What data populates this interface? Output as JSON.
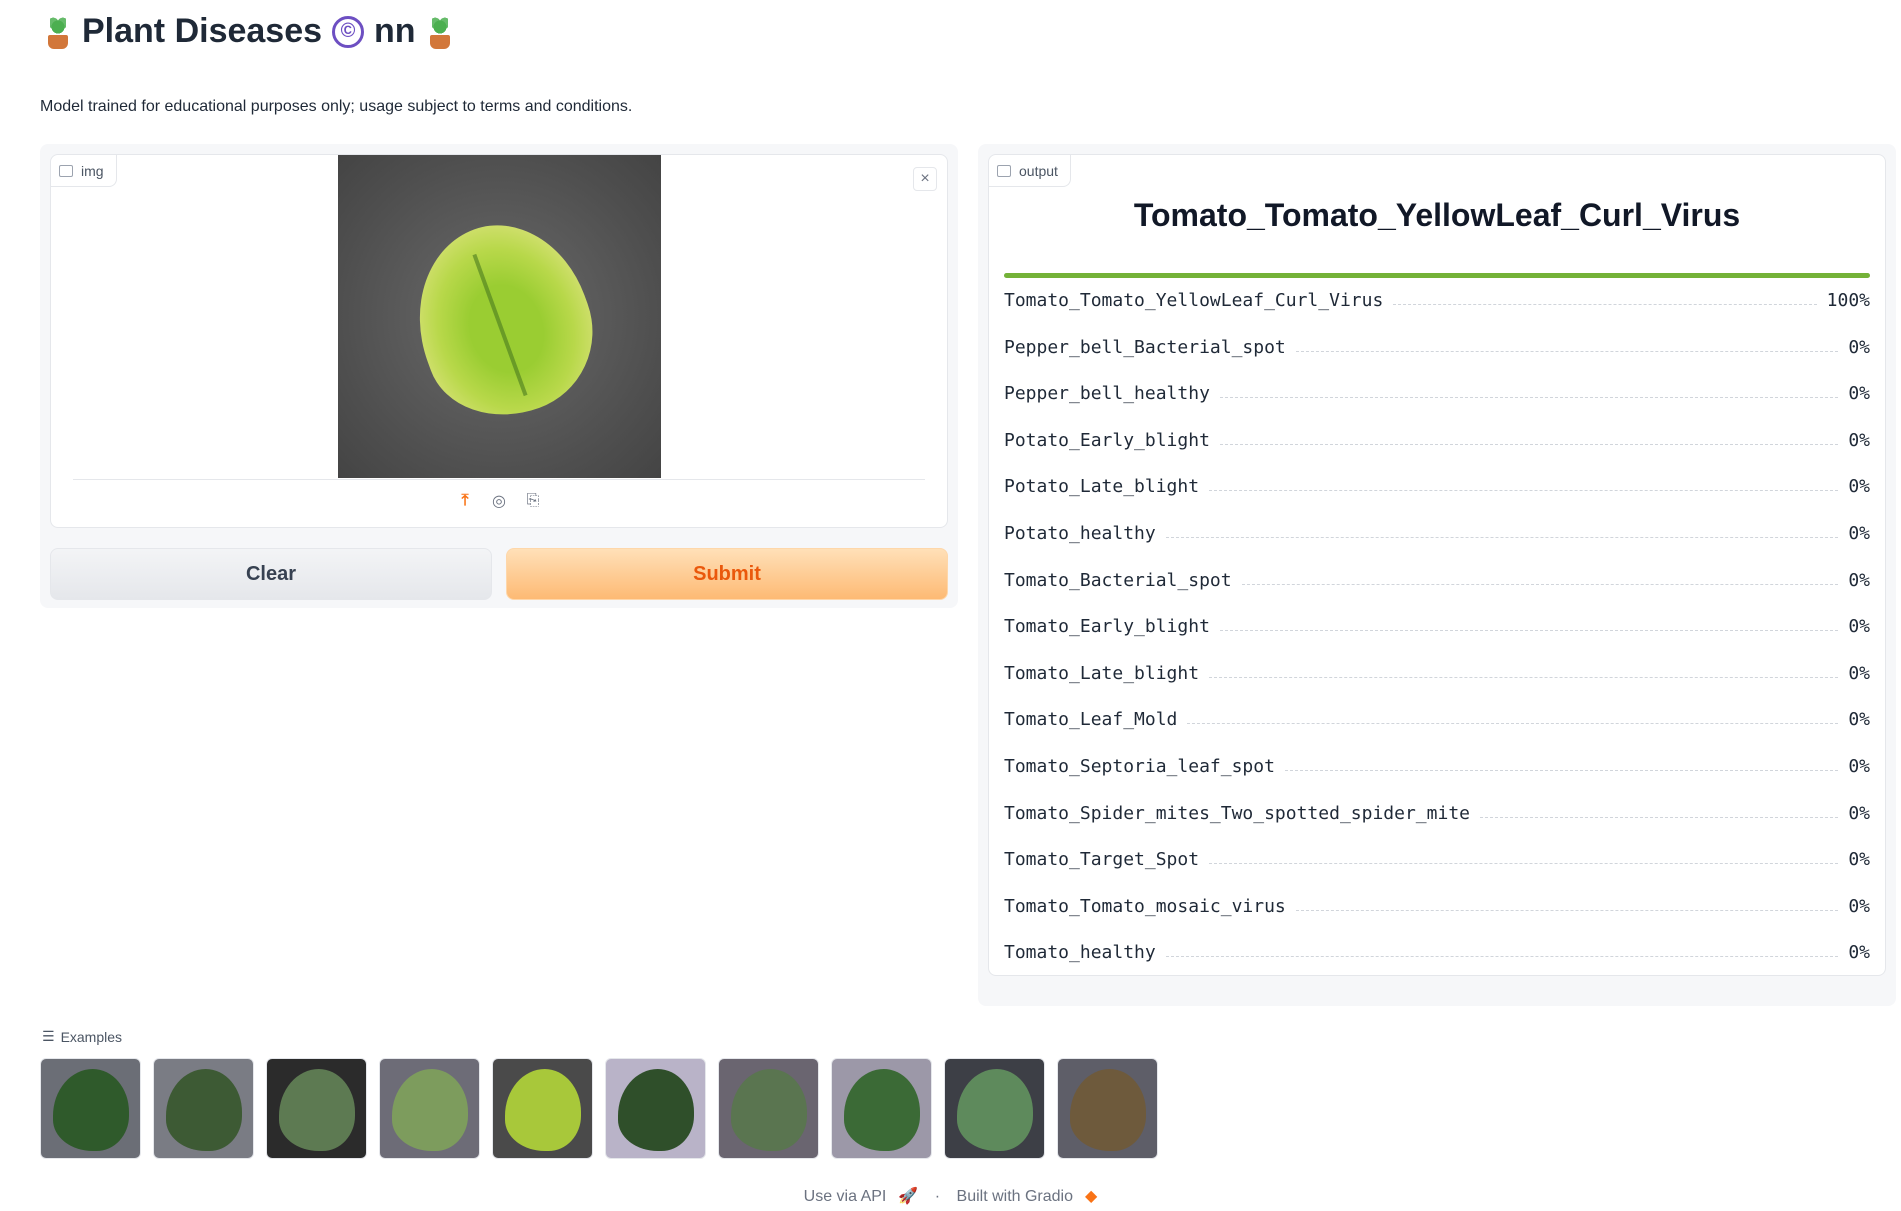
{
  "header": {
    "title": "Plant Diseases",
    "title_suffix": "nn",
    "copyright_glyph": "©",
    "description": "Model trained for educational purposes only; usage subject to terms and conditions."
  },
  "input": {
    "label": "img",
    "close_glyph": "×",
    "source_icons": [
      "upload-icon",
      "webcam-icon",
      "clipboard-icon"
    ]
  },
  "buttons": {
    "clear": "Clear",
    "submit": "Submit"
  },
  "output": {
    "label": "output",
    "top_class": "Tomato_Tomato_YellowLeaf_Curl_Virus",
    "top_confidence": 1.0,
    "confidences": [
      {
        "name": "Tomato_Tomato_YellowLeaf_Curl_Virus",
        "pct": "100%"
      },
      {
        "name": "Pepper_bell_Bacterial_spot",
        "pct": "0%"
      },
      {
        "name": "Pepper_bell_healthy",
        "pct": "0%"
      },
      {
        "name": "Potato_Early_blight",
        "pct": "0%"
      },
      {
        "name": "Potato_Late_blight",
        "pct": "0%"
      },
      {
        "name": "Potato_healthy",
        "pct": "0%"
      },
      {
        "name": "Tomato_Bacterial_spot",
        "pct": "0%"
      },
      {
        "name": "Tomato_Early_blight",
        "pct": "0%"
      },
      {
        "name": "Tomato_Late_blight",
        "pct": "0%"
      },
      {
        "name": "Tomato_Leaf_Mold",
        "pct": "0%"
      },
      {
        "name": "Tomato_Septoria_leaf_spot",
        "pct": "0%"
      },
      {
        "name": "Tomato_Spider_mites_Two_spotted_spider_mite",
        "pct": "0%"
      },
      {
        "name": "Tomato_Target_Spot",
        "pct": "0%"
      },
      {
        "name": "Tomato_Tomato_mosaic_virus",
        "pct": "0%"
      },
      {
        "name": "Tomato_healthy",
        "pct": "0%"
      }
    ]
  },
  "examples": {
    "label": "Examples",
    "items": [
      {
        "bg": "#6b6e76",
        "leaf": "#2f5a2b"
      },
      {
        "bg": "#7a7c84",
        "leaf": "#3d5a34"
      },
      {
        "bg": "#2b2b2b",
        "leaf": "#5d7a52"
      },
      {
        "bg": "#6d6c77",
        "leaf": "#7d9c5d"
      },
      {
        "bg": "#4a4a4a",
        "leaf": "#a8c83a"
      },
      {
        "bg": "#b9b3c8",
        "leaf": "#2f4f2a"
      },
      {
        "bg": "#6a6570",
        "leaf": "#5a7550"
      },
      {
        "bg": "#9c98a8",
        "leaf": "#3b6a36"
      },
      {
        "bg": "#3d3f46",
        "leaf": "#5e8a5c"
      },
      {
        "bg": "#5e5e68",
        "leaf": "#6e5a3c"
      }
    ]
  },
  "footer": {
    "api": "Use via API",
    "separator": "·",
    "built": "Built with Gradio"
  },
  "colors": {
    "accent": "#f97316",
    "confidence_bar": "#74b238"
  }
}
